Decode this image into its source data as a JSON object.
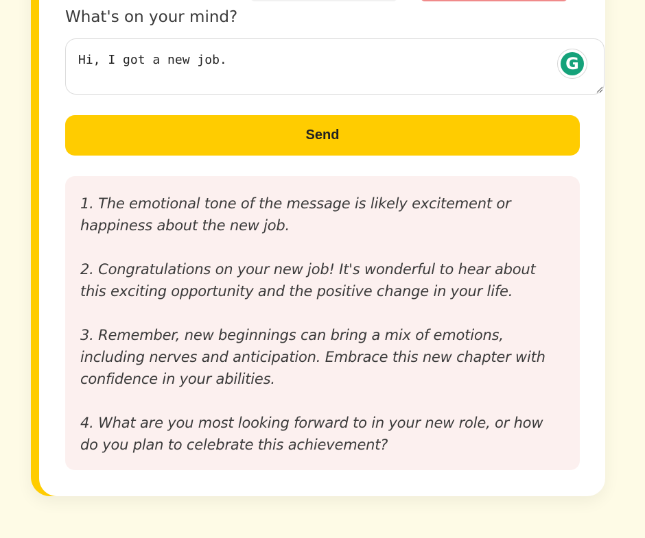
{
  "form": {
    "prompt_label": "What's on your mind?",
    "input_value": "Hi, I got a new job.",
    "send_label": "Send",
    "grammarly_letter": "G"
  },
  "response": {
    "items": [
      "1. The emotional tone of the message is likely excitement or happiness about the new job.",
      "2. Congratulations on your new job! It's wonderful to hear about this exciting opportunity and the positive change in your life.",
      "3. Remember, new beginnings can bring a mix of emotions, including nerves and anticipation. Embrace this new chapter with confidence in your abilities.",
      "4. What are you most looking forward to in your new role, or how do you plan to celebrate this achievement?"
    ]
  },
  "colors": {
    "accent": "#ffcc00",
    "page_background": "#fefbe6",
    "response_background": "#fcf0ef",
    "grammarly": "#15a27a"
  }
}
